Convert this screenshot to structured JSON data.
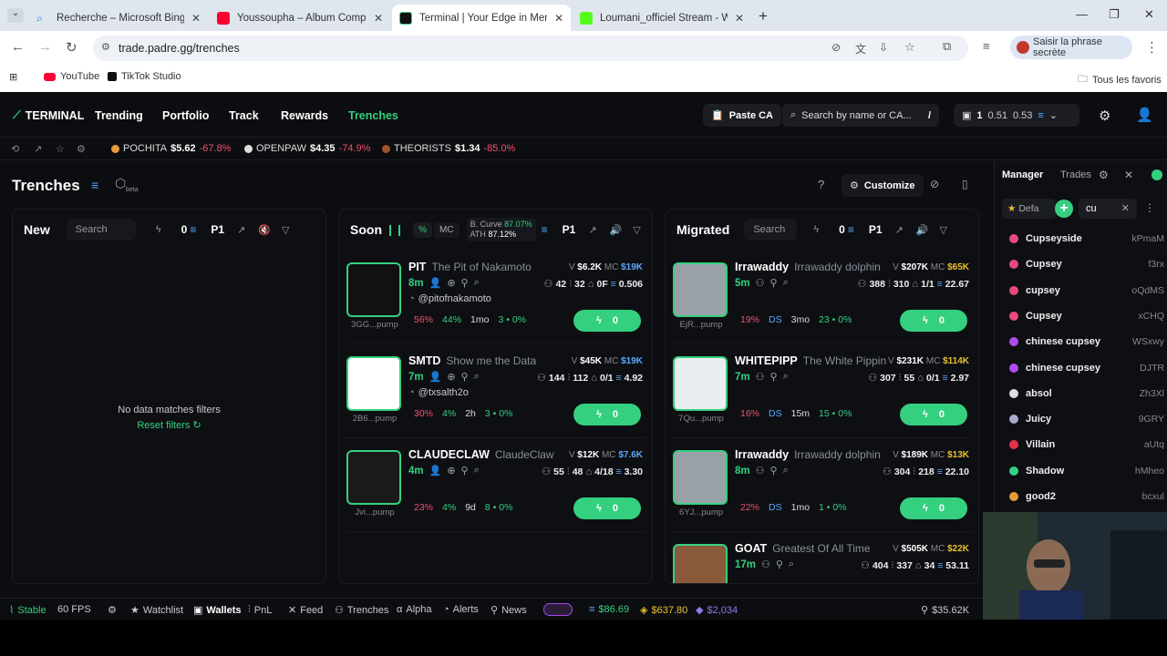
{
  "browser": {
    "tabs": [
      {
        "title": "Recherche – Microsoft Bing",
        "color": "#1a73e8"
      },
      {
        "title": "Youssoupha – Album Complet",
        "color": "#ff0033"
      },
      {
        "title": "Terminal | Your Edge in Memecoin",
        "color": "#111111"
      },
      {
        "title": "Loumani_officiel Stream - Watch",
        "color": "#53fc18"
      }
    ],
    "url": "trade.padre.gg/trenches",
    "secret_button": "Saisir la phrase secrète",
    "bookmarks": [
      "YouTube",
      "TikTok Studio"
    ],
    "all_bookmarks": "Tous les favoris"
  },
  "app": {
    "logo": "TERMINAL",
    "nav": [
      "Trending",
      "Portfolio",
      "Track",
      "Rewards",
      "Trenches"
    ],
    "paste_ca": "Paste CA",
    "search_placeholder": "Search by name or CA...",
    "search_shortcut": "/",
    "wallet": {
      "count": "1",
      "sol": "0.51",
      "usd": "0.53"
    },
    "tickers": [
      {
        "name": "POCHITA",
        "price": "$5.62",
        "change": "-67.8%"
      },
      {
        "name": "OPENPAW",
        "price": "$4.35",
        "change": "-74.9%"
      },
      {
        "name": "THEORISTS",
        "price": "$1.34",
        "change": "-85.0%"
      }
    ],
    "page_title": "Trenches",
    "beta": "beta",
    "customize": "Customize"
  },
  "columns": {
    "new": {
      "title": "New",
      "search": "Search",
      "amount": "0",
      "preset": "P1",
      "empty": "No data matches filters",
      "reset": "Reset filters"
    },
    "soon": {
      "title": "Soon",
      "pct": "%",
      "mc": "MC",
      "bcurve_label": "B. Curve",
      "bcurve_val": "87.07%",
      "ath_label": "ATH",
      "ath_val": "87.12%",
      "preset": "P1"
    },
    "migrated": {
      "title": "Migrated",
      "search": "Search",
      "amount": "0",
      "preset": "P1"
    }
  },
  "soon_cards": [
    {
      "sym": "PIT",
      "name": "The Pit of Nakamoto",
      "age": "8m",
      "v": "$6.2K",
      "mc": "$19K",
      "holders": "42",
      "txs": "32",
      "ratio": "0F",
      "sol": "0.506",
      "handle": "@pitofnakamoto",
      "addr": "3GG...pump",
      "s1": "56%",
      "s2": "44%",
      "s3": "1mo",
      "s4": "3 • 0%",
      "buy": "0"
    },
    {
      "sym": "SMTD",
      "name": "Show me the Data",
      "age": "7m",
      "v": "$45K",
      "mc": "$19K",
      "holders": "144",
      "txs": "112",
      "ratio": "0/1",
      "sol": "4.92",
      "handle": "@txsalth2o",
      "addr": "2B6...pump",
      "s1": "30%",
      "s2": "4%",
      "s3": "2h",
      "s4": "3 • 0%",
      "buy": "0"
    },
    {
      "sym": "CLAUDECLAW",
      "name": "ClaudeClaw",
      "age": "4m",
      "v": "$12K",
      "mc": "$7.6K",
      "holders": "55",
      "txs": "48",
      "ratio": "4/18",
      "sol": "3.30",
      "handle": "",
      "addr": "Jvi...pump",
      "s1": "23%",
      "s2": "4%",
      "s3": "9d",
      "s4": "8 • 0%",
      "buy": "0"
    }
  ],
  "migrated_cards": [
    {
      "sym": "Irrawaddy",
      "name": "Irrawaddy dolphin",
      "age": "5m",
      "v": "$207K",
      "mc": "$65K",
      "holders": "388",
      "txs": "310",
      "ratio": "1/1",
      "sol": "22.67",
      "addr": "EjR...pump",
      "s1": "19%",
      "s2": "DS",
      "s3": "3mo",
      "s4": "23 • 0%",
      "buy": "0"
    },
    {
      "sym": "WHITEPIPP",
      "name": "The White Pippin",
      "age": "7m",
      "v": "$231K",
      "mc": "$114K",
      "holders": "307",
      "txs": "55",
      "ratio": "0/1",
      "sol": "2.97",
      "addr": "7Qu...pump",
      "s1": "16%",
      "s2": "DS",
      "s3": "15m",
      "s4": "15 • 0%",
      "buy": "0"
    },
    {
      "sym": "Irrawaddy",
      "name": "Irrawaddy dolphin",
      "age": "8m",
      "v": "$189K",
      "mc": "$13K",
      "holders": "304",
      "txs": "218",
      "ratio": "",
      "sol": "22.10",
      "addr": "6YJ...pump",
      "s1": "22%",
      "s2": "DS",
      "s3": "1mo",
      "s4": "1 • 0%",
      "buy": "0"
    },
    {
      "sym": "GOAT",
      "name": "Greatest Of All Time",
      "age": "17m",
      "v": "$505K",
      "mc": "$22K",
      "holders": "404",
      "txs": "337",
      "ratio": "34",
      "sol": "53.11",
      "addr": "",
      "s1": "",
      "s2": "",
      "s3": "",
      "s4": "",
      "buy": ""
    }
  ],
  "manager": {
    "tabs": [
      "Manager",
      "Trades"
    ],
    "preset": "Defa",
    "filter": "cu",
    "rows": [
      {
        "name": "Cupseyside",
        "addr": "kPmaM",
        "color": "#e84a7f"
      },
      {
        "name": "Cupsey",
        "addr": "f3rx",
        "color": "#e84a7f"
      },
      {
        "name": "cupsey",
        "addr": "oQdMS",
        "color": "#e84a7f"
      },
      {
        "name": "Cupsey",
        "addr": "xCHQ",
        "color": "#e84a7f"
      },
      {
        "name": "chinese cupsey",
        "addr": "WSxwy",
        "color": "#b04cf0"
      },
      {
        "name": "chinese cupsey",
        "addr": "DJTR",
        "color": "#b04cf0"
      },
      {
        "name": "absol",
        "addr": "Zh3Xl",
        "color": "#dddddd"
      },
      {
        "name": "Juicy",
        "addr": "9GRY",
        "color": "#aaaacc"
      },
      {
        "name": "Villain",
        "addr": "aUtq",
        "color": "#e8304a"
      },
      {
        "name": "Shadow",
        "addr": "hMheo",
        "color": "#35d07f"
      },
      {
        "name": "good2",
        "addr": "bcxul",
        "color": "#e89a3a"
      }
    ]
  },
  "footer": {
    "status": "Stable",
    "fps": "60 FPS",
    "items": [
      "Watchlist",
      "Wallets",
      "PnL",
      "Feed",
      "Trenches",
      "Alpha",
      "Alerts",
      "News"
    ],
    "sol_price": "$86.69",
    "btc_price": "$637.80",
    "eth_price": "$2,034",
    "vol": "$35.62K"
  }
}
